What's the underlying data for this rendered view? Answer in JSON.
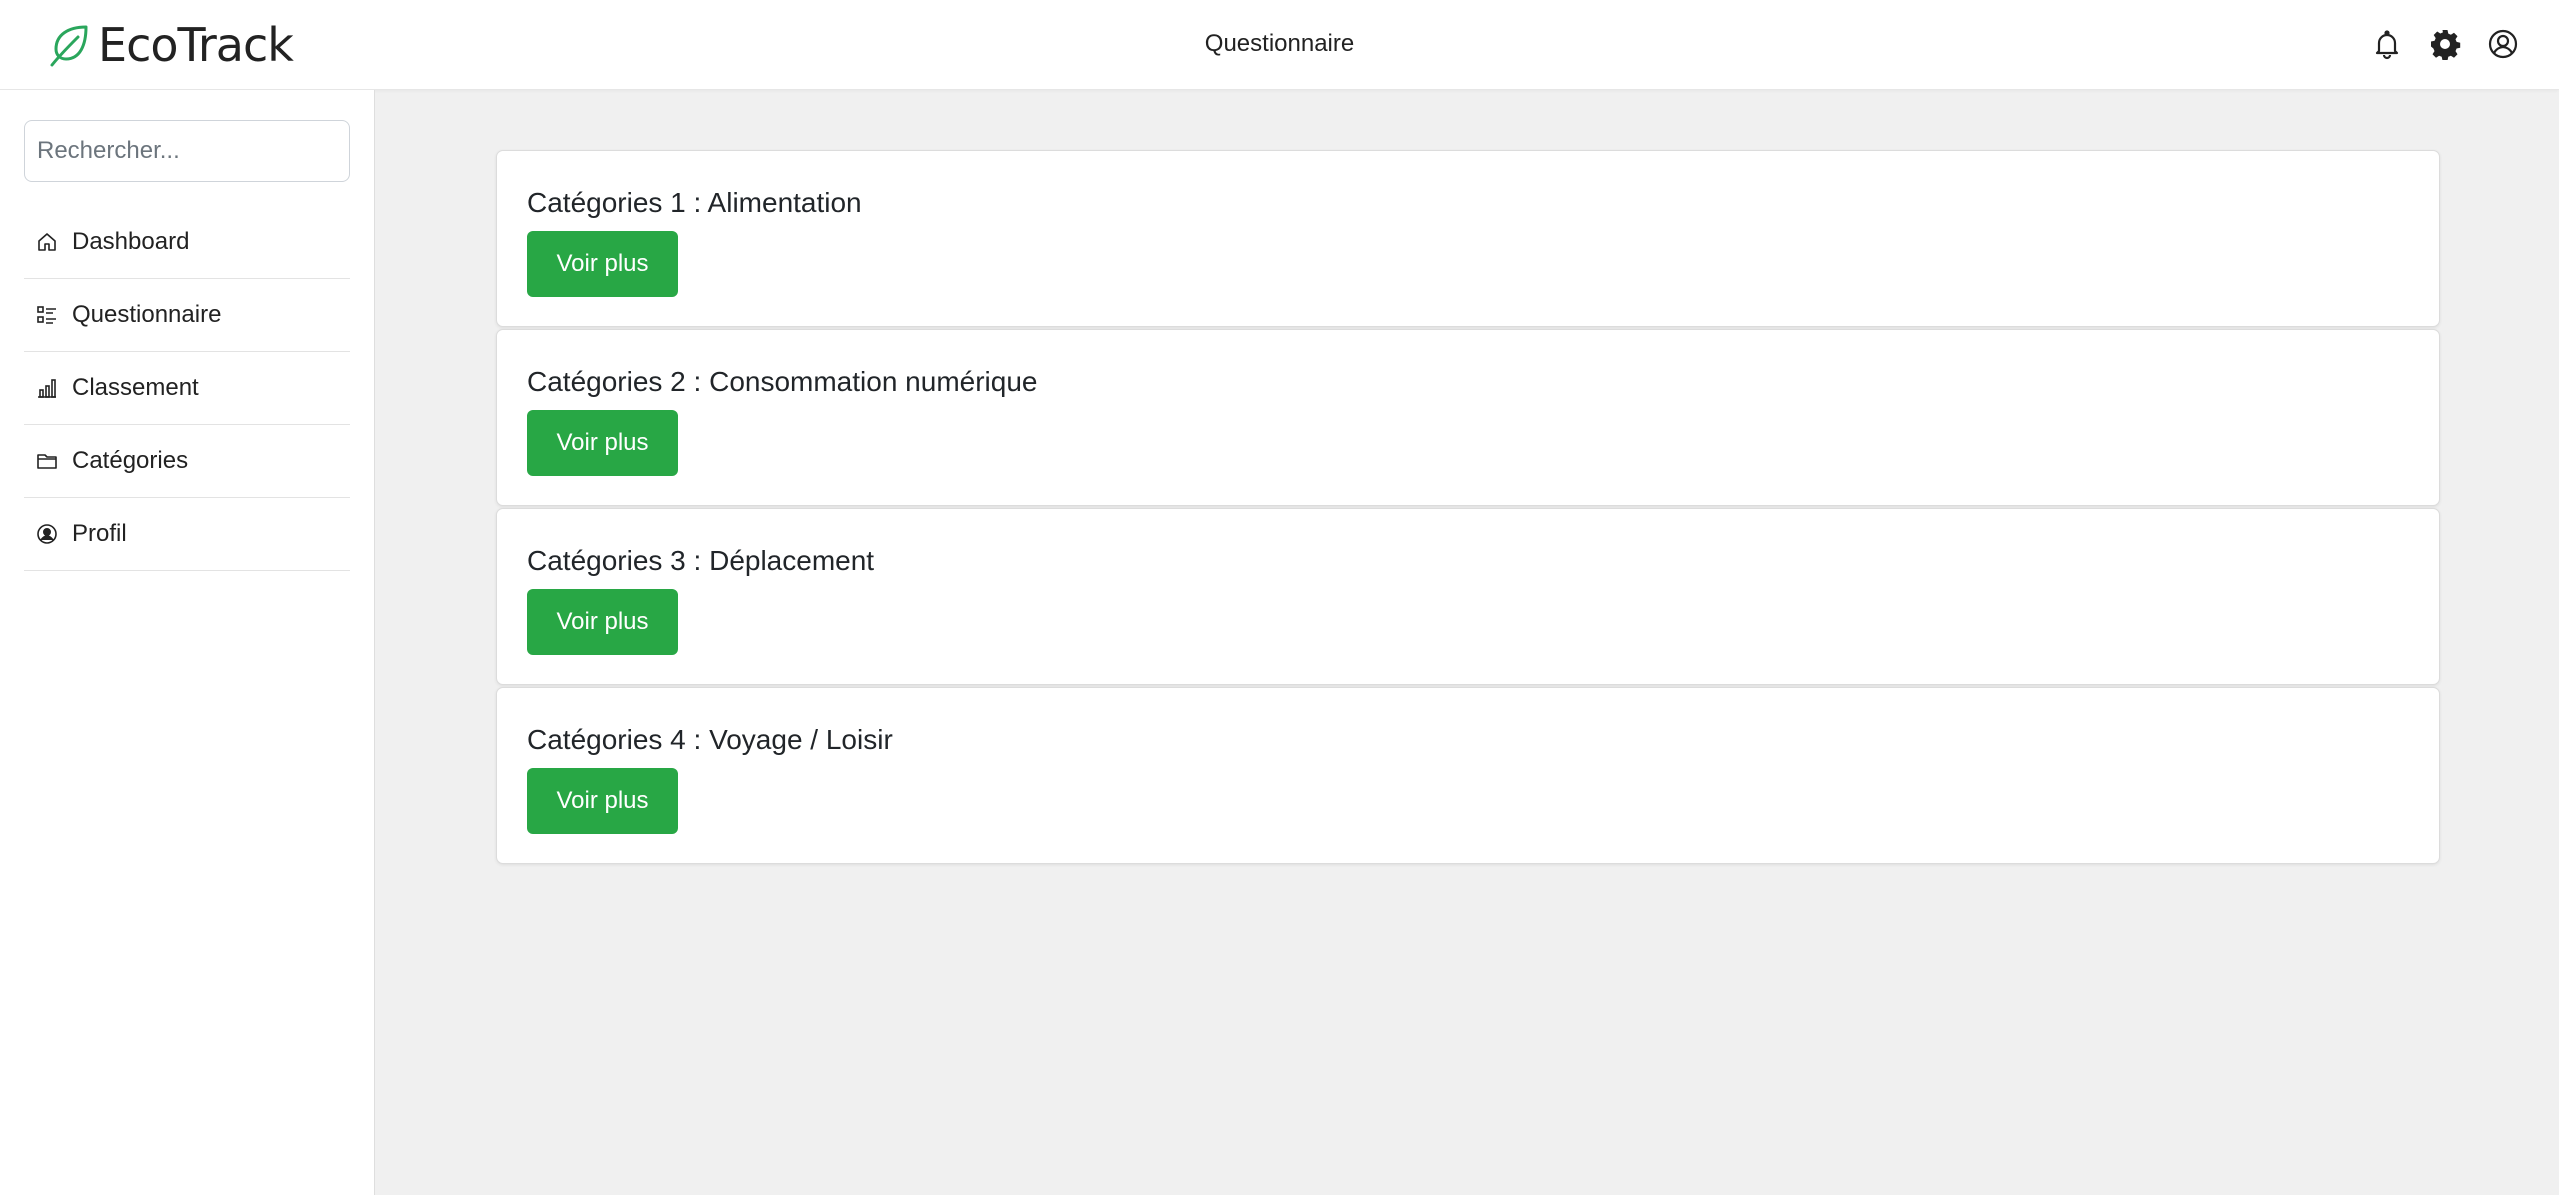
{
  "brand": {
    "name": "EcoTrack",
    "color": "#2aa65c"
  },
  "header": {
    "title": "Questionnaire"
  },
  "icons": [
    "notification-bell-icon",
    "settings-gear-icon",
    "user-account-icon"
  ],
  "sidebar": {
    "search_placeholder": "Rechercher...",
    "items": [
      {
        "label": "Dashboard",
        "icon": "home-icon"
      },
      {
        "label": "Questionnaire",
        "icon": "checklist-icon"
      },
      {
        "label": "Classement",
        "icon": "bar-chart-icon"
      },
      {
        "label": "Catégories",
        "icon": "folder-icon"
      },
      {
        "label": "Profil",
        "icon": "user-circle-icon"
      }
    ]
  },
  "theme": {
    "button_color": "#28a745",
    "background": "#f0f0f0"
  },
  "categories": [
    {
      "title": "Catégories 1 : Alimentation",
      "button_label": "Voir plus"
    },
    {
      "title": "Catégories 2 : Consommation numérique",
      "button_label": "Voir plus"
    },
    {
      "title": "Catégories 3 : Déplacement",
      "button_label": "Voir plus"
    },
    {
      "title": "Catégories 4 : Voyage / Loisir",
      "button_label": "Voir plus"
    }
  ]
}
